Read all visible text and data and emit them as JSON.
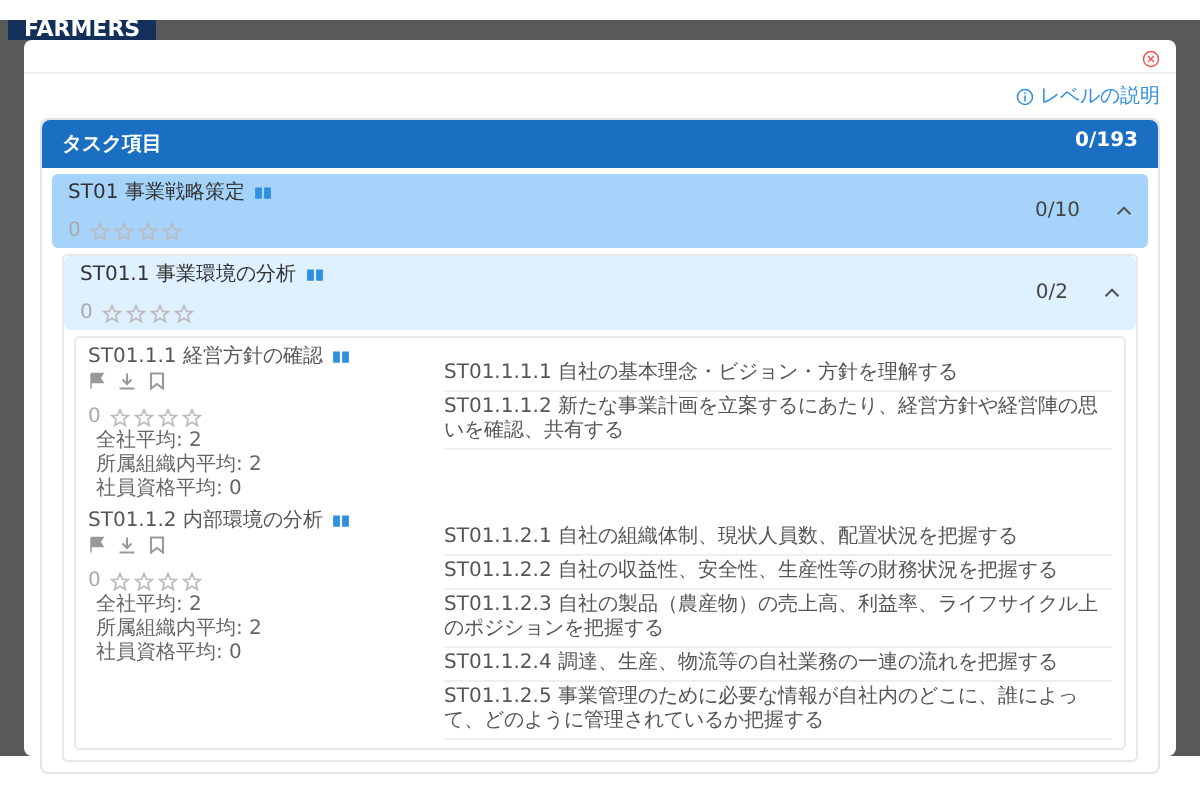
{
  "backdrop": {
    "logo": "FARMERS"
  },
  "modal": {
    "level_help_link": "レベルの説明"
  },
  "task_header": {
    "title": "タスク項目",
    "count": "0/193"
  },
  "sections": [
    {
      "title": "ST01 事業戦略策定",
      "score": "0",
      "stars": 0,
      "count": "0/10",
      "expanded": true,
      "subsections": [
        {
          "title": "ST01.1 事業環境の分析",
          "score": "0",
          "stars": 0,
          "count": "0/2",
          "expanded": true,
          "items": [
            {
              "title": "ST01.1.1 経営方針の確認",
              "score": "0",
              "stars": 0,
              "averages": [
                "全社平均: 2",
                "所属組織内平均: 2",
                "社員資格平均: 0"
              ],
              "tasks": [
                "ST01.1.1.1 自社の基本理念・ビジョン・方針を理解する",
                "ST01.1.1.2 新たな事業計画を立案するにあたり、経営方針や経営陣の思いを確認、共有する"
              ]
            },
            {
              "title": "ST01.1.2 内部環境の分析",
              "score": "0",
              "stars": 0,
              "averages": [
                "全社平均: 2",
                "所属組織内平均: 2",
                "社員資格平均: 0"
              ],
              "tasks": [
                "ST01.1.2.1 自社の組織体制、現状人員数、配置状況を把握する",
                "ST01.1.2.2 自社の収益性、安全性、生産性等の財務状況を把握する",
                "ST01.1.2.3 自社の製品（農産物）の売上高、利益率、ライフサイクル上のポジションを把握する",
                "ST01.1.2.4 調達、生産、物流等の自社業務の一連の流れを把握する",
                "ST01.1.2.5 事業管理のために必要な情報が自社内のどこに、誰によって、どのように管理されているか把握する"
              ]
            }
          ]
        }
      ]
    }
  ]
}
